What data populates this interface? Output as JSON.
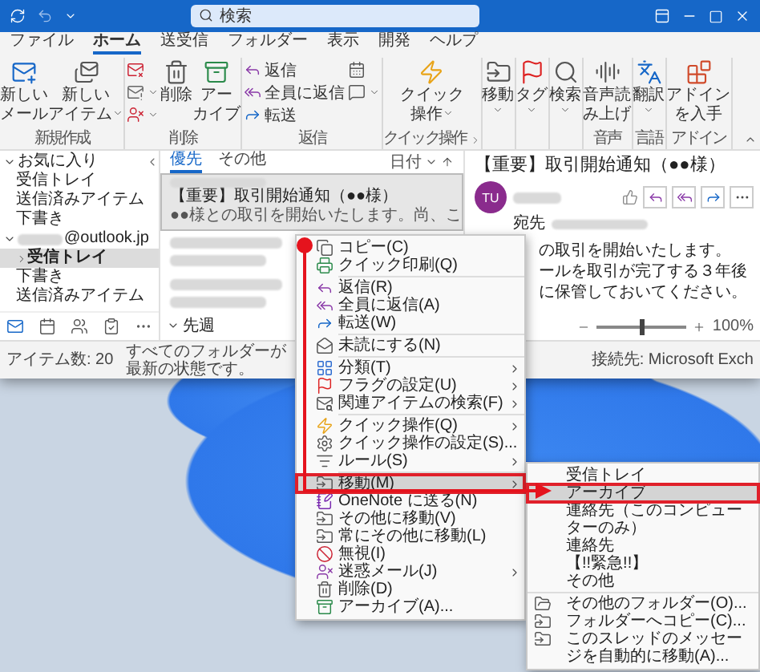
{
  "search": {
    "placeholder": "検索"
  },
  "menu_tabs": [
    {
      "label": "ファイル",
      "selected": false
    },
    {
      "label": "ホーム",
      "selected": true
    },
    {
      "label": "送受信",
      "selected": false
    },
    {
      "label": "フォルダー",
      "selected": false
    },
    {
      "label": "表示",
      "selected": false
    },
    {
      "label": "開発",
      "selected": false
    },
    {
      "label": "ヘルプ",
      "selected": false
    }
  ],
  "ribbon": [
    {
      "label": "新規作成",
      "launcher": false,
      "columns": [
        [
          {
            "lines": [
              "新しい",
              "メール"
            ],
            "dropdown": false
          }
        ],
        [
          {
            "lines": [
              "新しい",
              "アイテム"
            ],
            "dropdown": true
          }
        ]
      ]
    },
    {
      "label": "削除",
      "launcher": false,
      "columns": [
        [
          {
            "dropdown": false
          },
          {
            "dropdown": true
          },
          {
            "dropdown": true
          }
        ],
        [
          {
            "lines": [
              "削除"
            ],
            "dropdown": false
          }
        ],
        [
          {
            "lines": [
              "アー",
              "カイブ"
            ],
            "dropdown": false
          }
        ]
      ]
    },
    {
      "label": "返信",
      "launcher": false,
      "columns": [
        [
          {
            "label": "返信",
            "dropdown": false
          },
          {
            "label": "全員に返信",
            "dropdown": false
          },
          {
            "label": "転送",
            "dropdown": false
          }
        ],
        [
          {
            "dropdown": false
          },
          {
            "dropdown": true
          }
        ]
      ]
    },
    {
      "label": "クイック操作",
      "launcher": true,
      "columns": [
        [
          {
            "lines": [
              "クイック",
              "操作"
            ],
            "dropdown": true
          }
        ]
      ]
    },
    {
      "launcher": false,
      "columns": [
        [
          {
            "lines": [
              "移動"
            ],
            "dropdown": true
          }
        ]
      ]
    },
    {
      "launcher": false,
      "columns": [
        [
          {
            "lines": [
              "タグ"
            ],
            "dropdown": true
          }
        ]
      ]
    },
    {
      "launcher": false,
      "columns": [
        [
          {
            "lines": [
              "検索"
            ],
            "dropdown": true
          }
        ]
      ]
    },
    {
      "label": "音声",
      "launcher": false,
      "columns": [
        [
          {
            "lines": [
              "音声読",
              "み上げ"
            ],
            "dropdown": false
          }
        ]
      ]
    },
    {
      "label": "言語",
      "launcher": false,
      "columns": [
        [
          {
            "lines": [
              "翻訳"
            ],
            "dropdown": true
          }
        ]
      ]
    },
    {
      "label": "アドイン",
      "launcher": false,
      "columns": [
        [
          {
            "lines": [
              "アドイン",
              "を入手"
            ],
            "dropdown": false
          }
        ]
      ]
    }
  ],
  "folder_pane": {
    "sections": [
      {
        "label": "お気に入り",
        "blurred_prefix": false,
        "expanded": true,
        "items": [
          {
            "label": "受信トレイ",
            "selected": false,
            "collapsed": false
          },
          {
            "label": "送信済みアイテム",
            "selected": false,
            "collapsed": false
          },
          {
            "label": "下書き",
            "selected": false,
            "collapsed": false
          }
        ]
      },
      {
        "label": "@outlook.jp",
        "blurred_prefix": true,
        "expanded": true,
        "items": [
          {
            "label": "受信トレイ",
            "selected": true,
            "collapsed": true
          },
          {
            "label": "下書き",
            "selected": false,
            "collapsed": false
          },
          {
            "label": "送信済みアイテム",
            "selected": false,
            "collapsed": false
          }
        ]
      }
    ]
  },
  "nav_bar": [
    {
      "selected": true
    },
    {
      "selected": false
    },
    {
      "selected": false
    },
    {
      "selected": false
    },
    {
      "selected": false
    }
  ],
  "message_list": {
    "tabs": [
      {
        "label": "優先",
        "selected": true
      },
      {
        "label": "その他",
        "selected": false
      }
    ],
    "sort_label": "日付",
    "messages": [
      {
        "subject": "【重要】取引開始通知（●●様）",
        "preview": "●●様との取引を開始いたします。尚、こ",
        "selected": true
      }
    ],
    "group": {
      "label": "先週",
      "expanded": true
    }
  },
  "reading_pane": {
    "subject": "【重要】取引開始通知（●●様）",
    "avatar": "TU",
    "to_label": "宛先",
    "body": [
      "の取引を開始いたします。",
      "ールを取引が完了する３年後",
      "に保管しておいてください。"
    ],
    "zoom": {
      "level": 0.5,
      "reading": "100%"
    }
  },
  "status_bar": [
    "アイテム数: 20",
    "すべてのフォルダーが最新の状態です。",
    "接続先: Microsoft Exch"
  ],
  "context_menu": [
    {
      "kind": "item",
      "label": "コピー(C)",
      "submenu": false,
      "selected": false
    },
    {
      "kind": "item",
      "label": "クイック印刷(Q)",
      "submenu": false,
      "selected": false
    },
    {
      "kind": "separator"
    },
    {
      "kind": "item",
      "label": "返信(R)",
      "submenu": false,
      "selected": false
    },
    {
      "kind": "item",
      "label": "全員に返信(A)",
      "submenu": false,
      "selected": false
    },
    {
      "kind": "item",
      "label": "転送(W)",
      "submenu": false,
      "selected": false
    },
    {
      "kind": "separator"
    },
    {
      "kind": "item",
      "label": "未読にする(N)",
      "submenu": false,
      "selected": false
    },
    {
      "kind": "separator"
    },
    {
      "kind": "item",
      "label": "分類(T)",
      "submenu": true,
      "selected": false
    },
    {
      "kind": "item",
      "label": "フラグの設定(U)",
      "submenu": true,
      "selected": false
    },
    {
      "kind": "item",
      "label": "関連アイテムの検索(F)",
      "submenu": true,
      "selected": false
    },
    {
      "kind": "separator"
    },
    {
      "kind": "item",
      "label": "クイック操作(Q)",
      "submenu": true,
      "selected": false
    },
    {
      "kind": "item",
      "label": "クイック操作の設定(S)...",
      "submenu": false,
      "selected": false
    },
    {
      "kind": "item",
      "label": "ルール(S)",
      "submenu": true,
      "selected": false
    },
    {
      "kind": "separator"
    },
    {
      "kind": "item",
      "label": "移動(M)",
      "submenu": true,
      "selected": true
    },
    {
      "kind": "item",
      "label": "OneNote に送る(N)",
      "submenu": false,
      "selected": false
    },
    {
      "kind": "item",
      "label": "その他に移動(V)",
      "submenu": false,
      "selected": false
    },
    {
      "kind": "item",
      "label": "常にその他に移動(L)",
      "submenu": false,
      "selected": false
    },
    {
      "kind": "item",
      "label": "無視(I)",
      "submenu": false,
      "selected": false
    },
    {
      "kind": "item",
      "label": "迷惑メール(J)",
      "submenu": true,
      "selected": false
    },
    {
      "kind": "item",
      "label": "削除(D)",
      "submenu": false,
      "selected": false
    },
    {
      "kind": "item",
      "label": "アーカイブ(A)...",
      "submenu": false,
      "selected": false
    }
  ],
  "move_submenu": [
    {
      "kind": "folder",
      "label": "受信トレイ",
      "selected": false
    },
    {
      "kind": "folder",
      "label": "アーカイブ",
      "selected": true
    },
    {
      "kind": "folder",
      "label": "連絡先（このコンピューターのみ）",
      "selected": false
    },
    {
      "kind": "folder",
      "label": "連絡先",
      "selected": false
    },
    {
      "kind": "folder",
      "label": "【!!緊急!!】",
      "selected": false
    },
    {
      "kind": "folder",
      "label": "その他",
      "selected": false
    },
    {
      "kind": "separator"
    },
    {
      "kind": "command",
      "label": "その他のフォルダー(O)...",
      "selected": false
    },
    {
      "kind": "command",
      "label": "フォルダーへコピー(C)...",
      "selected": false
    },
    {
      "kind": "command",
      "label": "このスレッドのメッセージを自動的に移動(A)...",
      "selected": false
    }
  ]
}
